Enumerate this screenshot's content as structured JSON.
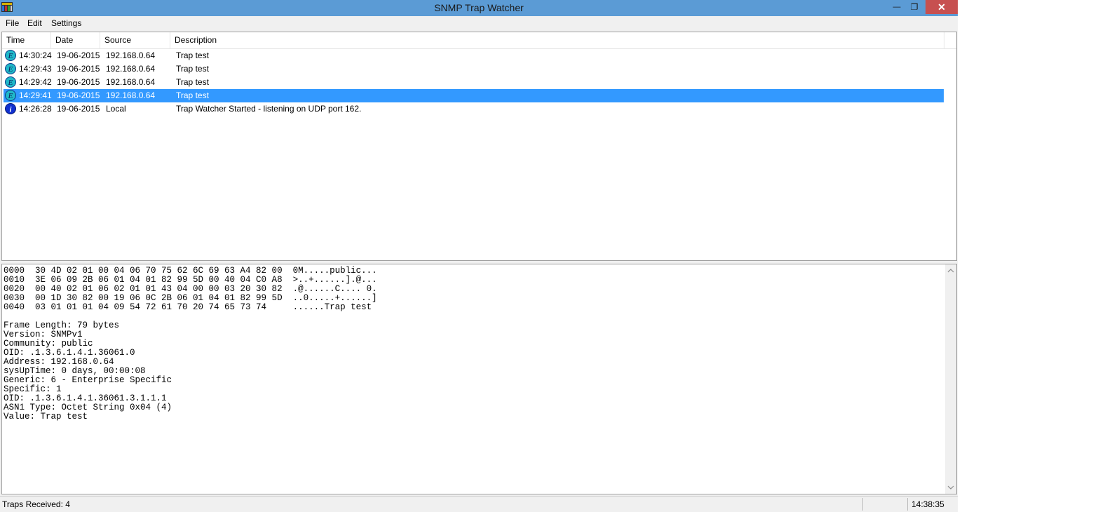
{
  "window": {
    "title": "SNMP Trap Watcher",
    "minimize_glyph": "—",
    "maximize_glyph": "❐",
    "close_glyph": "✕"
  },
  "menu": [
    "File",
    "Edit",
    "Settings"
  ],
  "list": {
    "columns": [
      "Time",
      "Date",
      "Source",
      "Description"
    ],
    "rows": [
      {
        "icon": "enterprise-icon",
        "time": "14:30:24",
        "date": "19-06-2015",
        "source": "192.168.0.64",
        "description": "Trap test",
        "selected": false
      },
      {
        "icon": "enterprise-icon",
        "time": "14:29:43",
        "date": "19-06-2015",
        "source": "192.168.0.64",
        "description": "Trap test",
        "selected": false
      },
      {
        "icon": "enterprise-icon",
        "time": "14:29:42",
        "date": "19-06-2015",
        "source": "192.168.0.64",
        "description": "Trap test",
        "selected": false
      },
      {
        "icon": "enterprise-icon",
        "time": "14:29:41",
        "date": "19-06-2015",
        "source": "192.168.0.64",
        "description": "Trap test",
        "selected": true
      },
      {
        "icon": "info-icon",
        "time": "14:26:28",
        "date": "19-06-2015",
        "source": "Local",
        "description": "Trap Watcher Started - listening on UDP port 162.",
        "selected": false
      }
    ],
    "selected_color": "#3399ff"
  },
  "detail": {
    "hex_lines": [
      "0000  30 4D 02 01 00 04 06 70 75 62 6C 69 63 A4 82 00  0M.....public...",
      "0010  3E 06 09 2B 06 01 04 01 82 99 5D 00 40 04 C0 A8  >..+......].@...",
      "0020  00 40 02 01 06 02 01 01 43 04 00 00 03 20 30 82  .@......C.... 0.",
      "0030  00 1D 30 82 00 19 06 0C 2B 06 01 04 01 82 99 5D  ..0.....+......]",
      "0040  03 01 01 01 04 09 54 72 61 70 20 74 65 73 74     ......Trap test"
    ],
    "info_lines": [
      "Frame Length: 79 bytes",
      "Version: SNMPv1",
      "Community: public",
      "OID: .1.3.6.1.4.1.36061.0",
      "Address: 192.168.0.64",
      "sysUpTime: 0 days, 00:00:08",
      "Generic: 6 - Enterprise Specific",
      "Specific: 1",
      "OID: .1.3.6.1.4.1.36061.3.1.1.1",
      "ASN1 Type: Octet String 0x04 (4)",
      "Value: Trap test"
    ]
  },
  "status": {
    "traps_received": "Traps Received: 4",
    "clock": "14:38:35"
  }
}
